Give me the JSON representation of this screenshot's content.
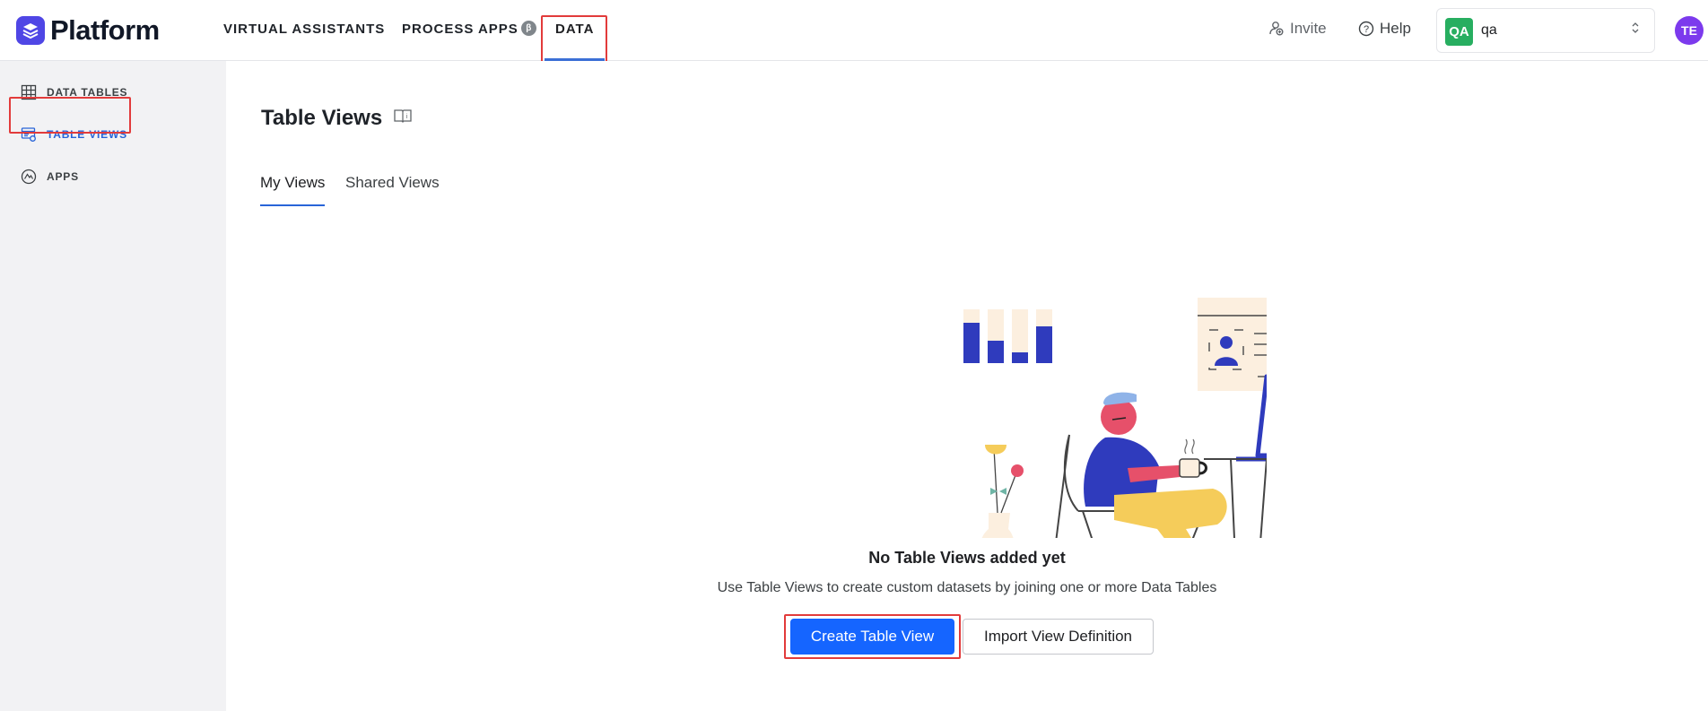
{
  "app": {
    "logo_text": "Platform"
  },
  "nav": {
    "items": [
      {
        "label": "VIRTUAL ASSISTANTS"
      },
      {
        "label": "PROCESS APPS",
        "badge": "β"
      },
      {
        "label": "DATA"
      }
    ]
  },
  "topbar": {
    "invite": "Invite",
    "help": "Help",
    "workspace": {
      "badge": "QA",
      "name": "qa",
      "caret_up": "⌃",
      "caret_down": "⌄"
    },
    "avatar": "TE"
  },
  "sidebar": {
    "items": [
      {
        "label": "DATA TABLES",
        "icon": "grid-table-icon"
      },
      {
        "label": "TABLE VIEWS",
        "icon": "table-view-icon"
      },
      {
        "label": "APPS",
        "icon": "apps-icon"
      }
    ]
  },
  "main": {
    "title": "Table Views",
    "tabs": [
      {
        "label": "My Views"
      },
      {
        "label": "Shared Views"
      }
    ],
    "empty": {
      "title": "No Table Views added yet",
      "subtitle": "Use Table Views to create custom datasets by joining one or more Data Tables"
    },
    "buttons": {
      "create": "Create Table View",
      "import": "Import View Definition"
    }
  },
  "colors": {
    "accent": "#2864d8",
    "primary_button": "#1565ff",
    "highlight": "#e23b3b",
    "workspace_badge": "#27ae60",
    "avatar": "#7c3aed",
    "logo": "#4f46e5"
  }
}
